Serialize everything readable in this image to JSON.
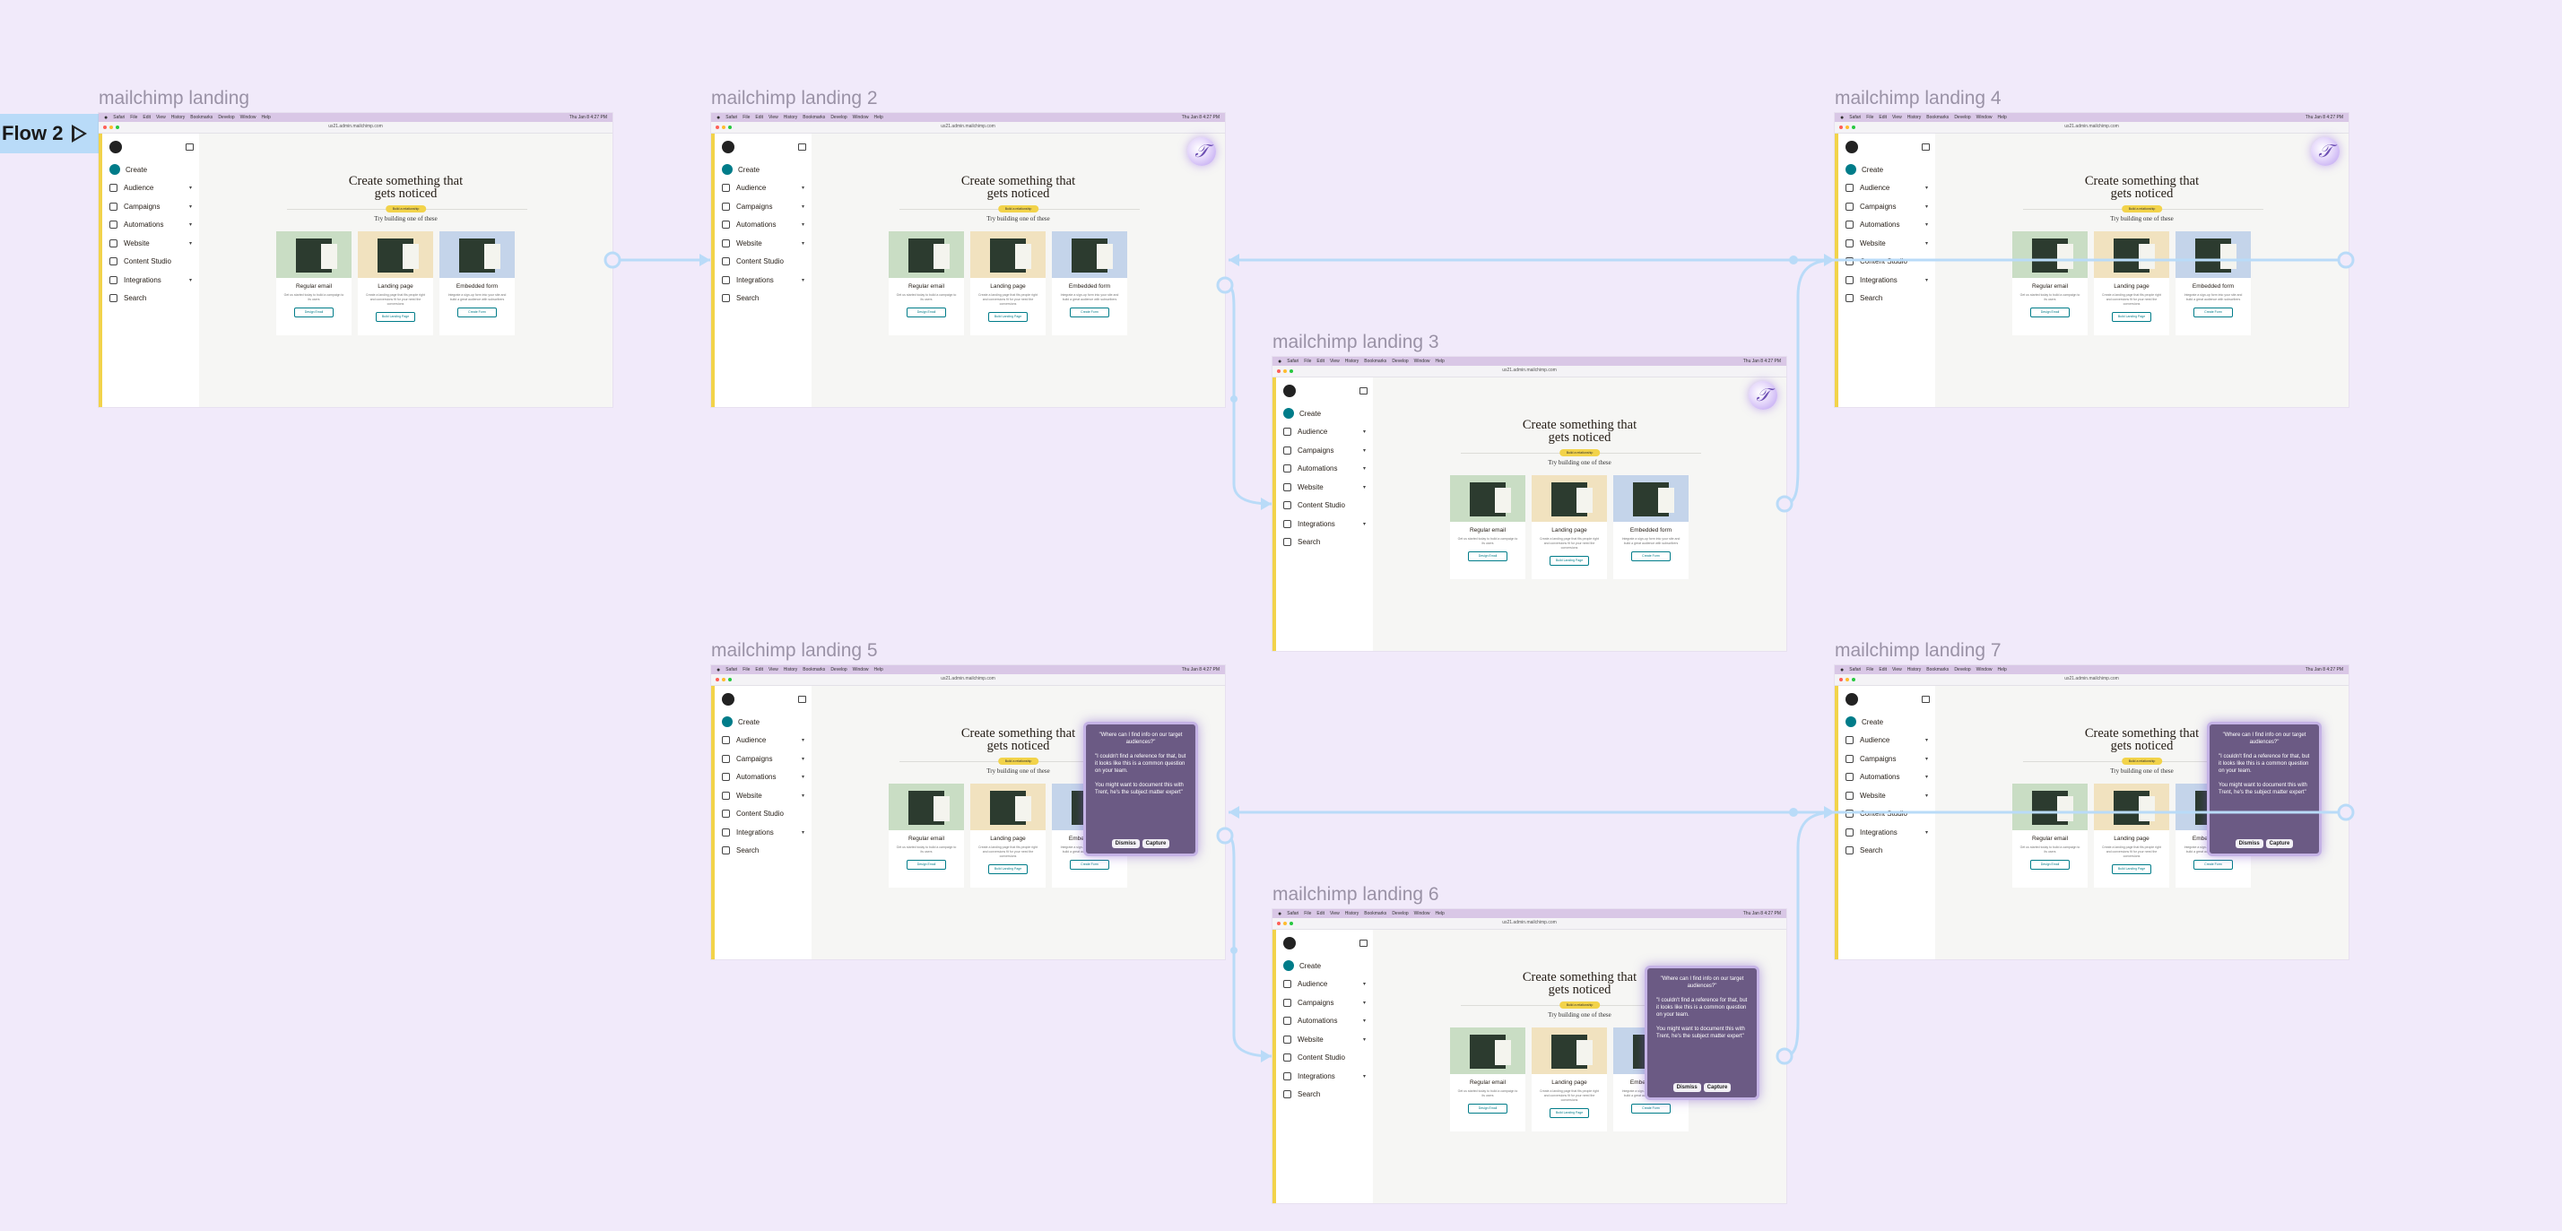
{
  "flow": {
    "label": "Flow 2"
  },
  "mock": {
    "menubar": [
      "Safari",
      "File",
      "Edit",
      "View",
      "History",
      "Bookmarks",
      "Develop",
      "Window",
      "Help"
    ],
    "clock": "Thu Jan 8 4:27 PM",
    "url": "us21.admin.mailchimp.com",
    "sidebar": [
      {
        "label": "Create",
        "chevron": false
      },
      {
        "label": "Audience",
        "chevron": true
      },
      {
        "label": "Campaigns",
        "chevron": true
      },
      {
        "label": "Automations",
        "chevron": true
      },
      {
        "label": "Website",
        "chevron": true
      },
      {
        "label": "Content Studio",
        "chevron": false
      },
      {
        "label": "Integrations",
        "chevron": true
      },
      {
        "label": "Search",
        "chevron": false
      }
    ],
    "heading_line1": "Create something that",
    "heading_line2": "gets noticed",
    "pill": "Build a relationship",
    "try": "Try building one of these",
    "cards": [
      {
        "title": "Regular email",
        "desc": "Get us started today to build a campaign to its users",
        "button": "Design Email",
        "color": "#c9ddc4"
      },
      {
        "title": "Landing page",
        "desc": "Create a landing page that fits people right and conversions fit for your need the conversions",
        "button": "Build Landing Page",
        "color": "#f1e2bf"
      },
      {
        "title": "Embedded form",
        "desc": "Integrate a sign-up form into your site and build a great audience with subscribers",
        "button": "Create Form",
        "color": "#c4d4ea"
      }
    ],
    "badge_glyph": "𝒯",
    "popup": {
      "question": "\"Where can I find info on our target audiences?\"",
      "body1": "\"I couldn't find a reference for that, but it looks like this is a common question on your team.",
      "body2": "You might want to document this with Trent, he's the subject matter expert\"",
      "dismiss": "Dismiss",
      "capture": "Capture"
    }
  },
  "frames": [
    {
      "title": "mailchimp landing",
      "badge": false,
      "popup": false
    },
    {
      "title": "mailchimp landing  2",
      "badge": true,
      "popup": false
    },
    {
      "title": "mailchimp landing 3",
      "badge": true,
      "popup": false
    },
    {
      "title": "mailchimp landing 4",
      "badge": true,
      "popup": false
    },
    {
      "title": "mailchimp landing  5",
      "badge": false,
      "popup": true
    },
    {
      "title": "mailchimp landing 6",
      "badge": false,
      "popup": true
    },
    {
      "title": "mailchimp landing 7",
      "badge": false,
      "popup": true
    }
  ],
  "colors": {
    "wire": "#b9dbf8",
    "canvas": "#f1eafa"
  }
}
